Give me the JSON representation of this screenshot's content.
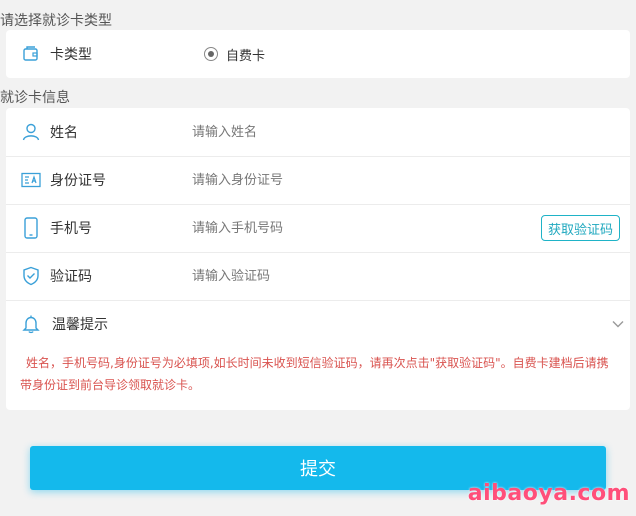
{
  "card_type_section": {
    "title": "请选择就诊卡类型",
    "label": "卡类型",
    "icon": "card-icon",
    "option": "自费卡"
  },
  "info_section": {
    "title": "就诊卡信息",
    "name": {
      "label": "姓名",
      "placeholder": "请输入姓名",
      "icon": "person-icon"
    },
    "id_number": {
      "label": "身份证号",
      "placeholder": "请输入身份证号",
      "icon": "id-card-icon"
    },
    "phone": {
      "label": "手机号",
      "placeholder": "请输入手机号码",
      "icon": "phone-icon",
      "button": "获取验证码"
    },
    "verify": {
      "label": "验证码",
      "placeholder": "请输入验证码",
      "icon": "shield-check-icon"
    }
  },
  "tips": {
    "label": "温馨提示",
    "icon": "bell-icon",
    "text": "姓名，手机号码,身份证号为必填项,如长时间未收到短信验证码，请再次点击\"获取验证码\"。自费卡建档后请携带身份证到前台导诊领取就诊卡。"
  },
  "submit_label": "提交",
  "watermark": "aibaoya.com",
  "colors": {
    "accent": "#14b9ec",
    "icon": "#3aa0d8",
    "warning_text": "#d9534f",
    "watermark": "#ff4f7a"
  }
}
